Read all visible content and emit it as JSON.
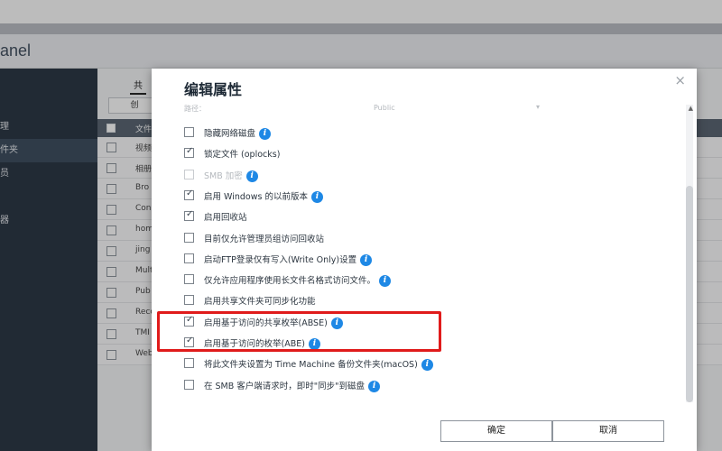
{
  "app": {
    "title": "anel"
  },
  "sidebar": {
    "items": [
      {
        "label": "理",
        "active": false
      },
      {
        "label": "件夹",
        "active": true
      },
      {
        "label": "员",
        "active": false
      },
      {
        "label": "器",
        "active": false
      }
    ]
  },
  "main": {
    "tab_label": "共",
    "create_button": "创",
    "column_header": "文件",
    "rows": [
      "视频",
      "相册",
      "Bro",
      "Con",
      "hom",
      "jing",
      "Mult",
      "Pub",
      "Reco",
      "TMI",
      "Web"
    ]
  },
  "dialog": {
    "title": "编辑属性",
    "path_label": "路径：",
    "path_value": "Public",
    "options": [
      {
        "label": "隐藏网络磁盘",
        "checked": false,
        "disabled": false,
        "info": true
      },
      {
        "label": "锁定文件 (oplocks)",
        "checked": true,
        "disabled": false,
        "info": false
      },
      {
        "label": "SMB 加密",
        "checked": false,
        "disabled": true,
        "info": true
      },
      {
        "label": "启用 Windows 的以前版本",
        "checked": true,
        "disabled": false,
        "info": true
      },
      {
        "label": "启用回收站",
        "checked": true,
        "disabled": false,
        "info": false
      },
      {
        "label": "目前仅允许管理员组访问回收站",
        "checked": false,
        "disabled": false,
        "info": false
      },
      {
        "label": "启动FTP登录仅有写入(Write Only)设置",
        "checked": false,
        "disabled": false,
        "info": true
      },
      {
        "label": "仅允许应用程序使用长文件名格式访问文件。",
        "checked": false,
        "disabled": false,
        "info": true
      },
      {
        "label": "启用共享文件夹可同步化功能",
        "checked": false,
        "disabled": false,
        "info": false
      },
      {
        "label": "启用基于访问的共享枚举(ABSE)",
        "checked": true,
        "disabled": false,
        "info": true
      },
      {
        "label": "启用基于访问的枚举(ABE)",
        "checked": true,
        "disabled": false,
        "info": true
      },
      {
        "label": "将此文件夹设置为 Time Machine 备份文件夹(macOS)",
        "checked": false,
        "disabled": false,
        "info": true
      },
      {
        "label": "在 SMB 客户端请求时，即时\"同步\"到磁盘",
        "checked": false,
        "disabled": false,
        "info": true
      }
    ],
    "ok_label": "确定",
    "cancel_label": "取消",
    "close_symbol": "×",
    "info_symbol": "i",
    "highlight_color": "#e01b1b",
    "accent_color": "#1e88e5"
  }
}
